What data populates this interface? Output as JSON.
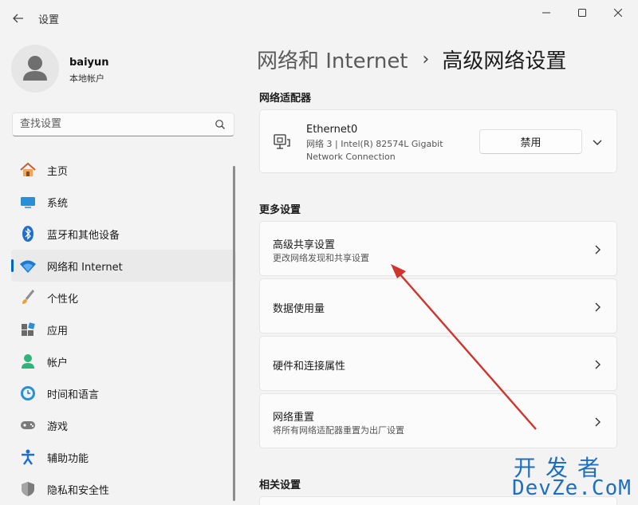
{
  "window": {
    "title": "设置",
    "controls": [
      "minimize",
      "maximize",
      "close"
    ]
  },
  "profile": {
    "name": "baiyun",
    "account_type": "本地帐户"
  },
  "search": {
    "placeholder": "查找设置"
  },
  "sidebar": {
    "items": [
      {
        "label": "主页",
        "icon": "home-icon",
        "active": false
      },
      {
        "label": "系统",
        "icon": "system-icon",
        "active": false
      },
      {
        "label": "蓝牙和其他设备",
        "icon": "bluetooth-icon",
        "active": false
      },
      {
        "label": "网络和 Internet",
        "icon": "wifi-icon",
        "active": true
      },
      {
        "label": "个性化",
        "icon": "brush-icon",
        "active": false
      },
      {
        "label": "应用",
        "icon": "apps-icon",
        "active": false
      },
      {
        "label": "帐户",
        "icon": "account-icon",
        "active": false
      },
      {
        "label": "时间和语言",
        "icon": "time-language-icon",
        "active": false
      },
      {
        "label": "游戏",
        "icon": "gamepad-icon",
        "active": false
      },
      {
        "label": "辅助功能",
        "icon": "accessibility-icon",
        "active": false
      },
      {
        "label": "隐私和安全性",
        "icon": "shield-icon",
        "active": false
      }
    ]
  },
  "breadcrumb": {
    "parent": "网络和 Internet",
    "separator": "›",
    "current": "高级网络设置"
  },
  "network_adapters": {
    "section_title": "网络适配器",
    "adapter": {
      "name": "Ethernet0",
      "description": "网络 3 | Intel(R) 82574L Gigabit Network Connection",
      "disable_label": "禁用"
    }
  },
  "more_settings": {
    "section_title": "更多设置",
    "items": [
      {
        "title": "高级共享设置",
        "subtitle": "更改网络发现和共享设置"
      },
      {
        "title": "数据使用量",
        "subtitle": ""
      },
      {
        "title": "硬件和连接属性",
        "subtitle": ""
      },
      {
        "title": "网络重置",
        "subtitle": "将所有网络适配器重置为出厂设置"
      }
    ]
  },
  "related_settings": {
    "section_title": "相关设置"
  },
  "watermark": {
    "top": "开发者",
    "bottom": "DevZe.CoM"
  },
  "colors": {
    "accent": "#0067c0",
    "annotation_arrow": "#d0342c"
  }
}
